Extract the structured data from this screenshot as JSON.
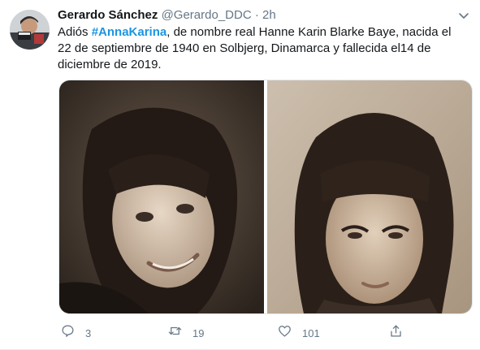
{
  "tweet": {
    "author_name": "Gerardo Sánchez",
    "author_handle": "@Gerardo_DDC",
    "separator": "·",
    "time": "2h",
    "text_before": "Adiós ",
    "hashtag": "#AnnaKarina",
    "text_after": ", de nombre real Hanne Karin Blarke Baye, nacida el 22 de septiembre de 1940 en Solbjerg, Dinamarca y fallecida el14 de diciembre de 2019."
  },
  "actions": {
    "replies": "3",
    "retweets": "19",
    "likes": "101"
  },
  "icons": {
    "avatar": "avatar-photo",
    "more": "chevron-down-icon",
    "reply": "reply-icon",
    "retweet": "retweet-icon",
    "like": "heart-icon",
    "share": "share-icon"
  },
  "colors": {
    "hashtag": "#1b95e0",
    "secondary_text": "#657786",
    "primary_text": "#14171a"
  }
}
